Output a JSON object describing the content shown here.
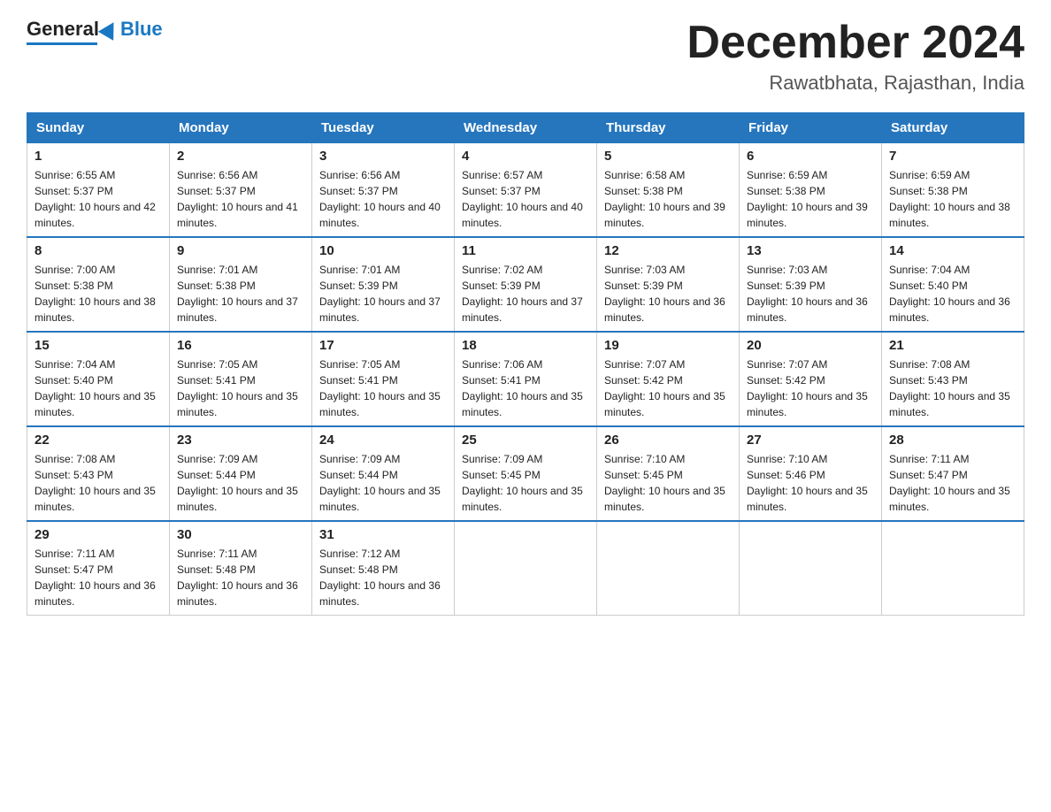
{
  "header": {
    "logo_general": "General",
    "logo_blue": "Blue",
    "title": "December 2024",
    "subtitle": "Rawatbhata, Rajasthan, India"
  },
  "days_of_week": [
    "Sunday",
    "Monday",
    "Tuesday",
    "Wednesday",
    "Thursday",
    "Friday",
    "Saturday"
  ],
  "weeks": [
    [
      {
        "day": "1",
        "sunrise": "6:55 AM",
        "sunset": "5:37 PM",
        "daylight": "10 hours and 42 minutes."
      },
      {
        "day": "2",
        "sunrise": "6:56 AM",
        "sunset": "5:37 PM",
        "daylight": "10 hours and 41 minutes."
      },
      {
        "day": "3",
        "sunrise": "6:56 AM",
        "sunset": "5:37 PM",
        "daylight": "10 hours and 40 minutes."
      },
      {
        "day": "4",
        "sunrise": "6:57 AM",
        "sunset": "5:37 PM",
        "daylight": "10 hours and 40 minutes."
      },
      {
        "day": "5",
        "sunrise": "6:58 AM",
        "sunset": "5:38 PM",
        "daylight": "10 hours and 39 minutes."
      },
      {
        "day": "6",
        "sunrise": "6:59 AM",
        "sunset": "5:38 PM",
        "daylight": "10 hours and 39 minutes."
      },
      {
        "day": "7",
        "sunrise": "6:59 AM",
        "sunset": "5:38 PM",
        "daylight": "10 hours and 38 minutes."
      }
    ],
    [
      {
        "day": "8",
        "sunrise": "7:00 AM",
        "sunset": "5:38 PM",
        "daylight": "10 hours and 38 minutes."
      },
      {
        "day": "9",
        "sunrise": "7:01 AM",
        "sunset": "5:38 PM",
        "daylight": "10 hours and 37 minutes."
      },
      {
        "day": "10",
        "sunrise": "7:01 AM",
        "sunset": "5:39 PM",
        "daylight": "10 hours and 37 minutes."
      },
      {
        "day": "11",
        "sunrise": "7:02 AM",
        "sunset": "5:39 PM",
        "daylight": "10 hours and 37 minutes."
      },
      {
        "day": "12",
        "sunrise": "7:03 AM",
        "sunset": "5:39 PM",
        "daylight": "10 hours and 36 minutes."
      },
      {
        "day": "13",
        "sunrise": "7:03 AM",
        "sunset": "5:39 PM",
        "daylight": "10 hours and 36 minutes."
      },
      {
        "day": "14",
        "sunrise": "7:04 AM",
        "sunset": "5:40 PM",
        "daylight": "10 hours and 36 minutes."
      }
    ],
    [
      {
        "day": "15",
        "sunrise": "7:04 AM",
        "sunset": "5:40 PM",
        "daylight": "10 hours and 35 minutes."
      },
      {
        "day": "16",
        "sunrise": "7:05 AM",
        "sunset": "5:41 PM",
        "daylight": "10 hours and 35 minutes."
      },
      {
        "day": "17",
        "sunrise": "7:05 AM",
        "sunset": "5:41 PM",
        "daylight": "10 hours and 35 minutes."
      },
      {
        "day": "18",
        "sunrise": "7:06 AM",
        "sunset": "5:41 PM",
        "daylight": "10 hours and 35 minutes."
      },
      {
        "day": "19",
        "sunrise": "7:07 AM",
        "sunset": "5:42 PM",
        "daylight": "10 hours and 35 minutes."
      },
      {
        "day": "20",
        "sunrise": "7:07 AM",
        "sunset": "5:42 PM",
        "daylight": "10 hours and 35 minutes."
      },
      {
        "day": "21",
        "sunrise": "7:08 AM",
        "sunset": "5:43 PM",
        "daylight": "10 hours and 35 minutes."
      }
    ],
    [
      {
        "day": "22",
        "sunrise": "7:08 AM",
        "sunset": "5:43 PM",
        "daylight": "10 hours and 35 minutes."
      },
      {
        "day": "23",
        "sunrise": "7:09 AM",
        "sunset": "5:44 PM",
        "daylight": "10 hours and 35 minutes."
      },
      {
        "day": "24",
        "sunrise": "7:09 AM",
        "sunset": "5:44 PM",
        "daylight": "10 hours and 35 minutes."
      },
      {
        "day": "25",
        "sunrise": "7:09 AM",
        "sunset": "5:45 PM",
        "daylight": "10 hours and 35 minutes."
      },
      {
        "day": "26",
        "sunrise": "7:10 AM",
        "sunset": "5:45 PM",
        "daylight": "10 hours and 35 minutes."
      },
      {
        "day": "27",
        "sunrise": "7:10 AM",
        "sunset": "5:46 PM",
        "daylight": "10 hours and 35 minutes."
      },
      {
        "day": "28",
        "sunrise": "7:11 AM",
        "sunset": "5:47 PM",
        "daylight": "10 hours and 35 minutes."
      }
    ],
    [
      {
        "day": "29",
        "sunrise": "7:11 AM",
        "sunset": "5:47 PM",
        "daylight": "10 hours and 36 minutes."
      },
      {
        "day": "30",
        "sunrise": "7:11 AM",
        "sunset": "5:48 PM",
        "daylight": "10 hours and 36 minutes."
      },
      {
        "day": "31",
        "sunrise": "7:12 AM",
        "sunset": "5:48 PM",
        "daylight": "10 hours and 36 minutes."
      },
      null,
      null,
      null,
      null
    ]
  ]
}
